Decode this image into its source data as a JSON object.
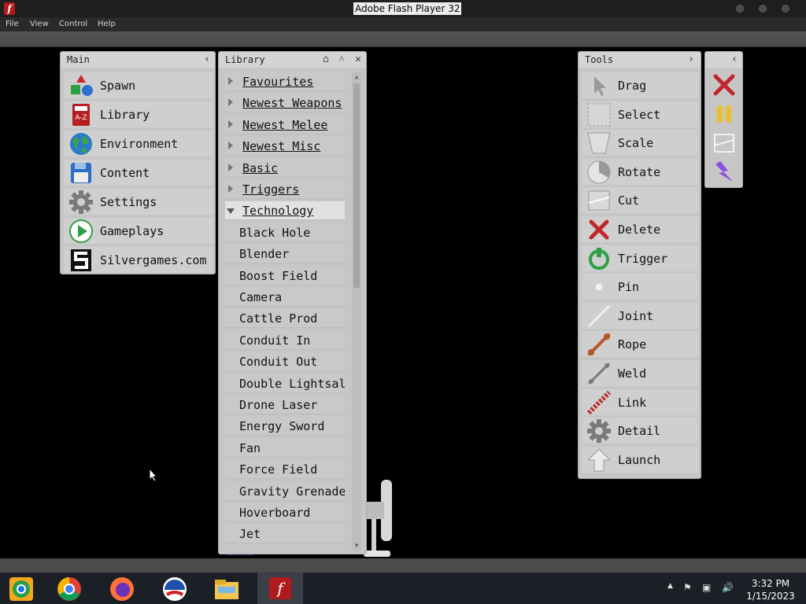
{
  "window": {
    "title": "Adobe Flash Player 32"
  },
  "menu": [
    "File",
    "View",
    "Control",
    "Help"
  ],
  "main_panel": {
    "title": "Main",
    "items": [
      {
        "label": "Spawn",
        "icon": "spawn-shapes-icon"
      },
      {
        "label": "Library",
        "icon": "library-book-icon"
      },
      {
        "label": "Environment",
        "icon": "globe-icon"
      },
      {
        "label": "Content",
        "icon": "floppy-disk-icon"
      },
      {
        "label": "Settings",
        "icon": "gear-icon"
      },
      {
        "label": "Gameplays",
        "icon": "play-icon"
      },
      {
        "label": "Silvergames.com",
        "icon": "silvergames-logo-icon"
      }
    ]
  },
  "library_panel": {
    "title": "Library",
    "categories": [
      "Favourites",
      "Newest Weapons",
      "Newest Melee",
      "Newest Misc",
      "Basic",
      "Triggers",
      "Technology"
    ],
    "open_category": "Technology",
    "items": [
      "Black Hole",
      "Blender",
      "Boost Field",
      "Camera",
      "Cattle Prod",
      "Conduit In",
      "Conduit Out",
      "Double Lightsal",
      "Drone Laser",
      "Energy Sword",
      "Fan",
      "Force Field",
      "Gravity Grenade",
      "Hoverboard",
      "Jet"
    ]
  },
  "tools_panel": {
    "title": "Tools",
    "items": [
      {
        "label": "Drag",
        "icon": "cursor-icon"
      },
      {
        "label": "Select",
        "icon": "select-box-icon"
      },
      {
        "label": "Scale",
        "icon": "scale-icon"
      },
      {
        "label": "Rotate",
        "icon": "rotate-icon"
      },
      {
        "label": "Cut",
        "icon": "cut-icon"
      },
      {
        "label": "Delete",
        "icon": "delete-x-icon"
      },
      {
        "label": "Trigger",
        "icon": "trigger-icon"
      },
      {
        "label": "Pin",
        "icon": "pin-icon"
      },
      {
        "label": "Joint",
        "icon": "joint-icon"
      },
      {
        "label": "Rope",
        "icon": "rope-icon"
      },
      {
        "label": "Weld",
        "icon": "weld-icon"
      },
      {
        "label": "Link",
        "icon": "link-icon"
      },
      {
        "label": "Detail",
        "icon": "detail-gear-icon"
      },
      {
        "label": "Launch",
        "icon": "launch-arrow-icon"
      }
    ]
  },
  "quick_panel": {
    "icons": [
      "clear-x-icon",
      "pause-icon",
      "cut-icon",
      "lightning-icon"
    ]
  },
  "clock": {
    "time": "3:32 PM",
    "date": "1/15/2023"
  },
  "colors": {
    "accent_red": "#c0272d",
    "panel": "#c6c6c6",
    "background": "#000000"
  }
}
